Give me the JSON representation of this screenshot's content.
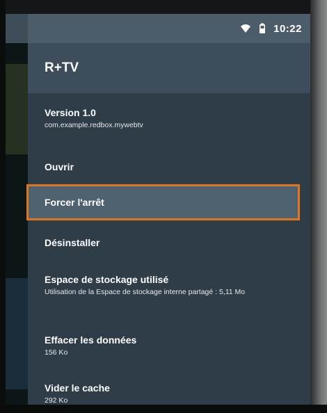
{
  "status_bar": {
    "time": "10:22",
    "icons": [
      "wifi-icon",
      "battery-icon"
    ]
  },
  "panel": {
    "app_title": "R+TV",
    "items": [
      {
        "title": "Version 1.0",
        "subtitle": "com.example.redbox.mywebtv"
      },
      {
        "title": "Ouvrir"
      },
      {
        "title": "Forcer l'arrêt",
        "selected": true
      },
      {
        "title": "Désinstaller"
      },
      {
        "title": "Espace de stockage utilisé",
        "subtitle": "Utilisation de la Espace de stockage interne partagé : 5,11 Mo"
      },
      {
        "title": "Effacer les données",
        "subtitle": "156 Ko"
      },
      {
        "title": "Vider le cache",
        "subtitle": "292 Ko"
      }
    ]
  },
  "colors": {
    "panel_bg": "#2e3d48",
    "header_bg": "#3d4d5b",
    "focus_border": "#e2761f"
  }
}
